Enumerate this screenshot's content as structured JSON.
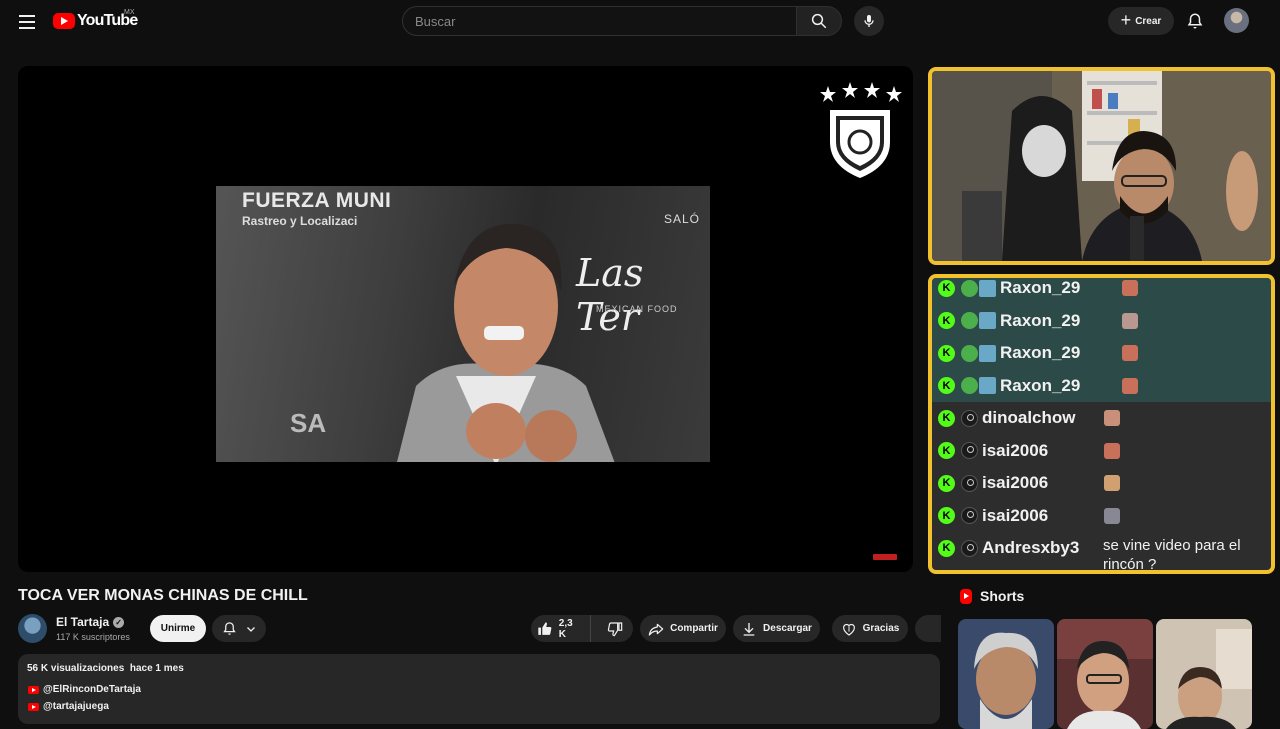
{
  "header": {
    "logo_text": "YouTube",
    "region": "MX",
    "search_placeholder": "Buscar",
    "create_label": "Crear"
  },
  "player": {
    "overlay_text": {
      "brand_line": "FUERZA MUNI",
      "sub_line": "Rastreo y Localizaci",
      "venue_script": "Las Ter",
      "venue_small": "MEXICAN FOOD",
      "salon": "SALÓ",
      "corner": "SA"
    }
  },
  "chat": {
    "messages": [
      {
        "user": "Raxon_29",
        "highlight": true,
        "avatar": "green",
        "extra_badge": true,
        "message": ""
      },
      {
        "user": "Raxon_29",
        "highlight": true,
        "avatar": "green",
        "extra_badge": true,
        "message": ""
      },
      {
        "user": "Raxon_29",
        "highlight": true,
        "avatar": "green",
        "extra_badge": true,
        "message": ""
      },
      {
        "user": "Raxon_29",
        "highlight": true,
        "avatar": "green",
        "extra_badge": true,
        "message": ""
      },
      {
        "user": "dinoalchow",
        "highlight": false,
        "avatar": "gray",
        "extra_badge": false,
        "message": ""
      },
      {
        "user": "isai2006",
        "highlight": false,
        "avatar": "gray",
        "extra_badge": false,
        "message": ""
      },
      {
        "user": "isai2006",
        "highlight": false,
        "avatar": "gray",
        "extra_badge": false,
        "message": ""
      },
      {
        "user": "isai2006",
        "highlight": false,
        "avatar": "gray",
        "extra_badge": false,
        "message": ""
      },
      {
        "user": "Andresxby3",
        "highlight": false,
        "avatar": "gray",
        "extra_badge": false,
        "message": "se vine video para el rincón ?"
      }
    ]
  },
  "video": {
    "title": "TOCA VER MONAS CHINAS DE CHILL",
    "channel": "El Tartaja",
    "subscribers": "117 K suscriptores",
    "join_label": "Unirme",
    "likes": "2,3 K",
    "share_label": "Compartir",
    "download_label": "Descargar",
    "thanks_label": "Gracias"
  },
  "description": {
    "views": "56 K visualizaciones",
    "age": "hace 1 mes",
    "links": [
      "@ElRinconDeTartaja",
      "@tartajajuega"
    ]
  },
  "shorts": {
    "heading": "Shorts"
  },
  "colors": {
    "accent_red": "#ff0000",
    "overlay_border": "#f2c12e",
    "kick_green": "#53fc18",
    "chat_highlight": "#2b4a48"
  }
}
